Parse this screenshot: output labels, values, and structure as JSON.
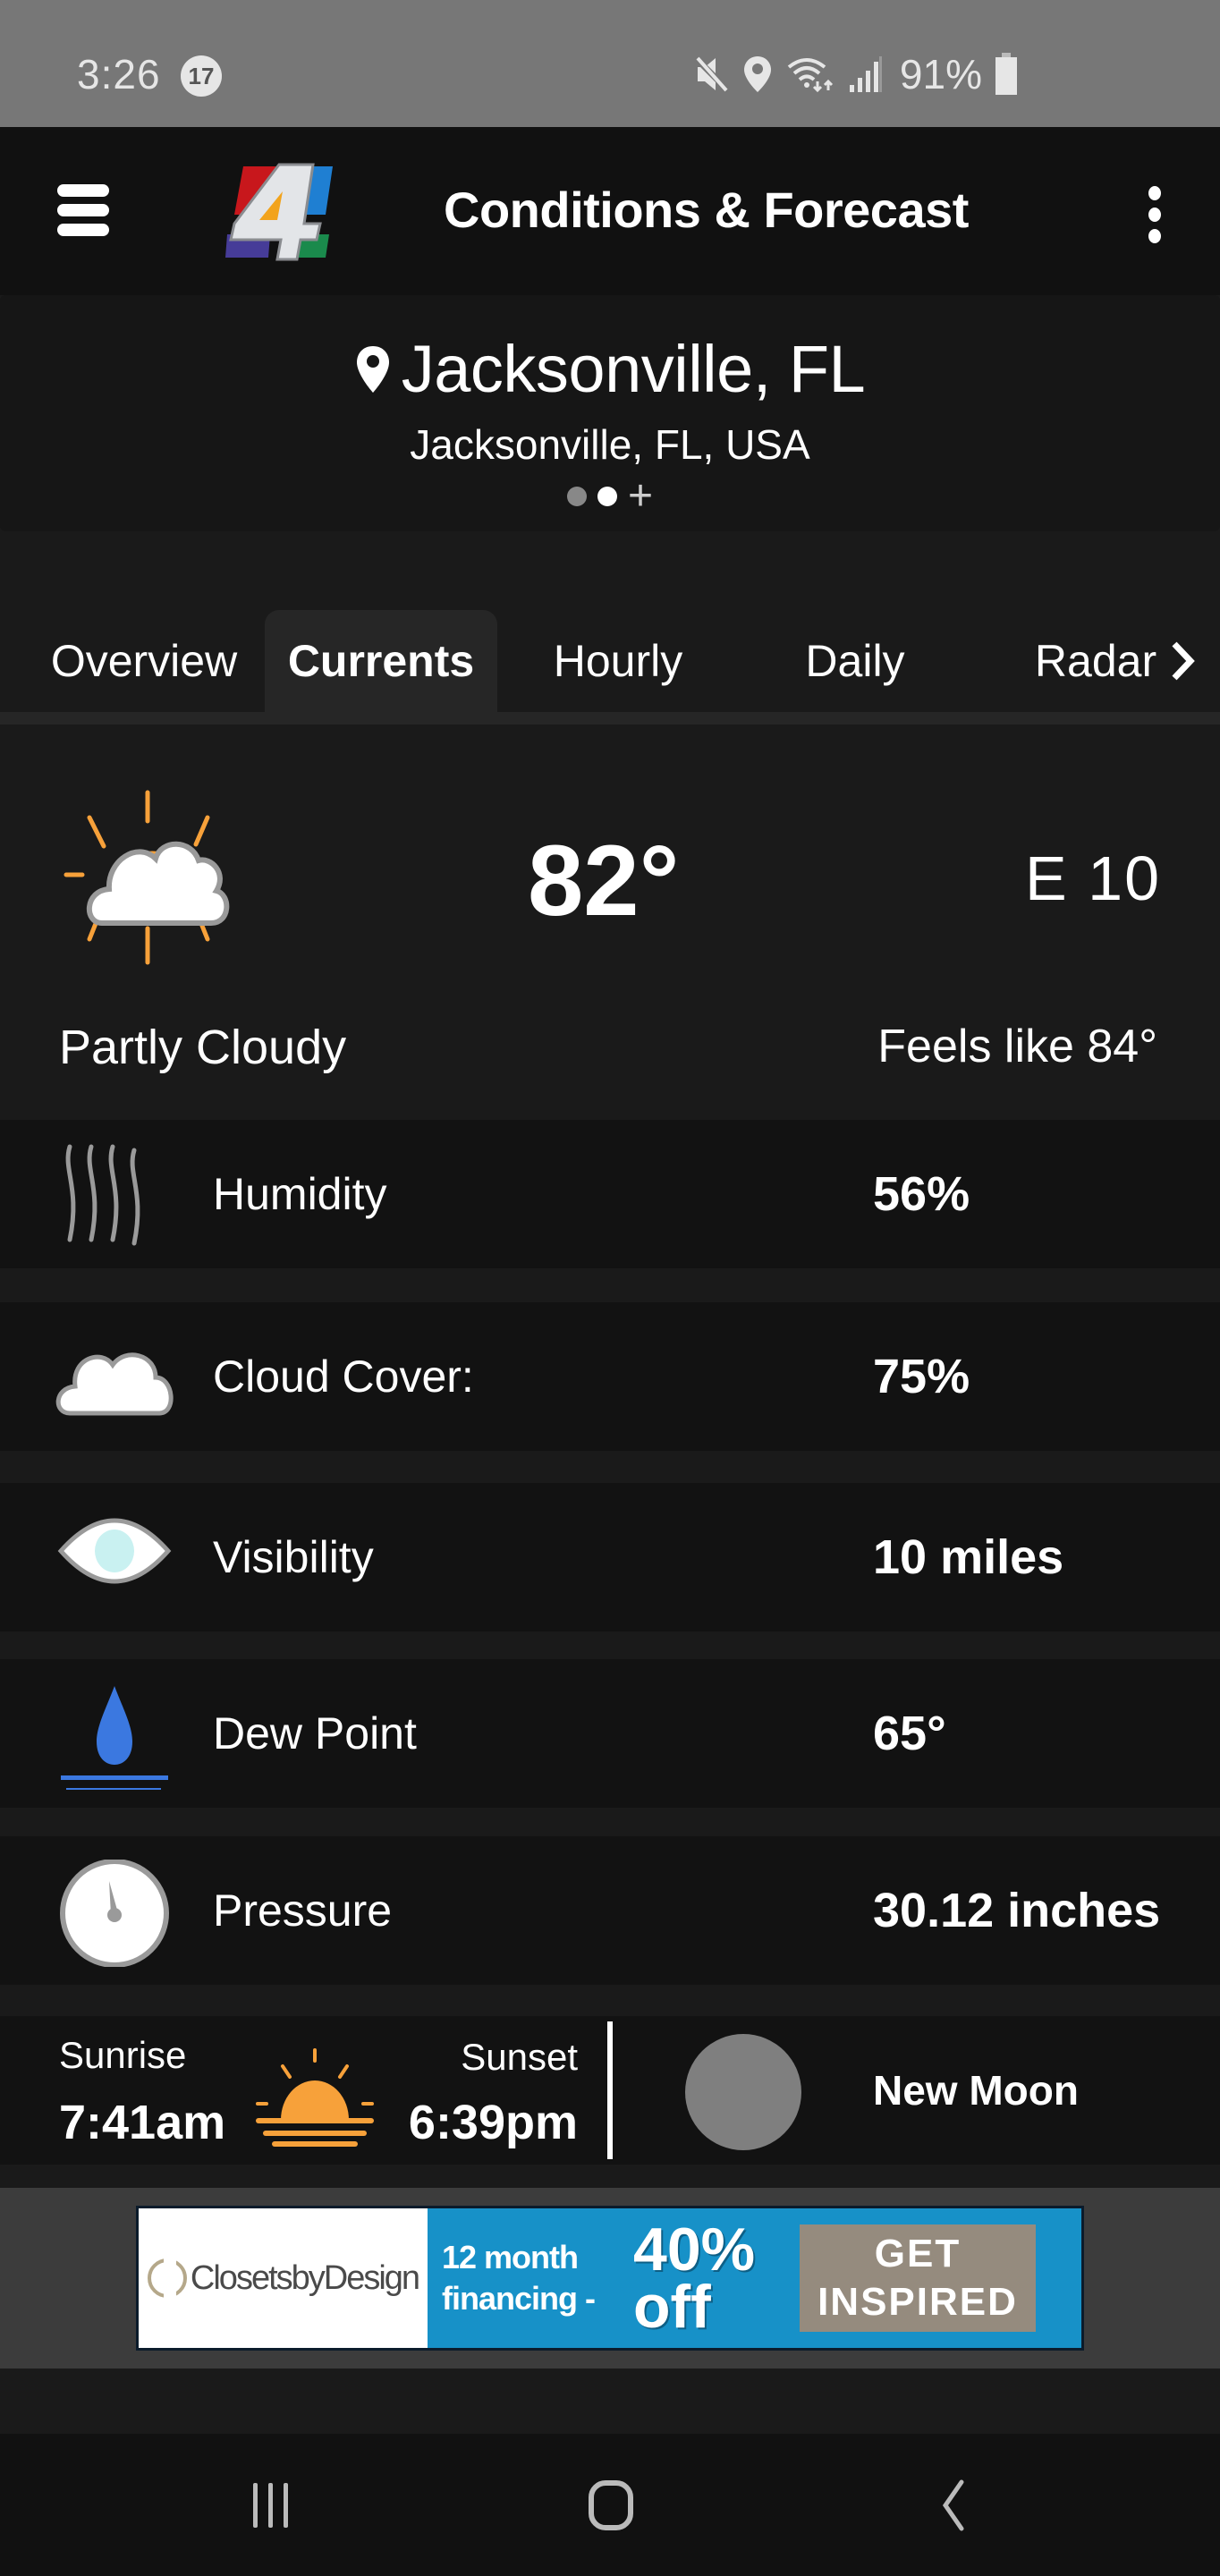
{
  "status_bar": {
    "time": "3:26",
    "notification_count": "17",
    "battery": "91%",
    "icons": [
      "mute-icon",
      "location-icon",
      "wifi-icon",
      "signal-icon",
      "battery-icon"
    ]
  },
  "app_bar": {
    "title": "Conditions & Forecast",
    "menu_icon": "hamburger-menu-icon",
    "logo": "channel-4-logo",
    "more_icon": "more-vertical-icon"
  },
  "location": {
    "name": "Jacksonville, FL",
    "full_name": "Jacksonville, FL, USA",
    "pages": 2,
    "active_page": 2,
    "add_label": "+"
  },
  "tabs": [
    {
      "label": "Overview",
      "active": false
    },
    {
      "label": "Currents",
      "active": true
    },
    {
      "label": "Hourly",
      "active": false
    },
    {
      "label": "Daily",
      "active": false
    },
    {
      "label": "Radar",
      "active": false
    }
  ],
  "current": {
    "icon": "partly-cloudy-icon",
    "temperature": "82°",
    "wind": "E  10",
    "condition": "Partly Cloudy",
    "feels_like": "Feels like 84°"
  },
  "details": [
    {
      "icon": "humidity-icon",
      "label": "Humidity",
      "value": "56%"
    },
    {
      "icon": "cloud-icon",
      "label": "Cloud Cover:",
      "value": "75%"
    },
    {
      "icon": "eye-icon",
      "label": "Visibility",
      "value": "10 miles"
    },
    {
      "icon": "dew-drop-icon",
      "label": "Dew Point",
      "value": "65°"
    },
    {
      "icon": "gauge-icon",
      "label": "Pressure",
      "value": "30.12 inches"
    }
  ],
  "sun_moon": {
    "sunrise_label": "Sunrise",
    "sunrise_time": "7:41am",
    "sunset_label": "Sunset",
    "sunset_time": "6:39pm",
    "moon_phase": "New Moon"
  },
  "ad": {
    "brand": "ClosetsbyDesign",
    "line1": "12 month",
    "line2": "financing -",
    "offer1": "40%",
    "offer2": "off",
    "cta1": "GET",
    "cta2": "INSPIRED"
  },
  "nav_bar": {
    "buttons": [
      "recent-apps",
      "home",
      "back"
    ]
  },
  "colors": {
    "background": "#1a1a1a",
    "row_background": "#121212",
    "status_bar": "#777777",
    "app_bar": "#111111",
    "sun_orange": "#f7a13a",
    "dew_blue": "#3b78e0",
    "ad_blue": "#1791c8"
  }
}
